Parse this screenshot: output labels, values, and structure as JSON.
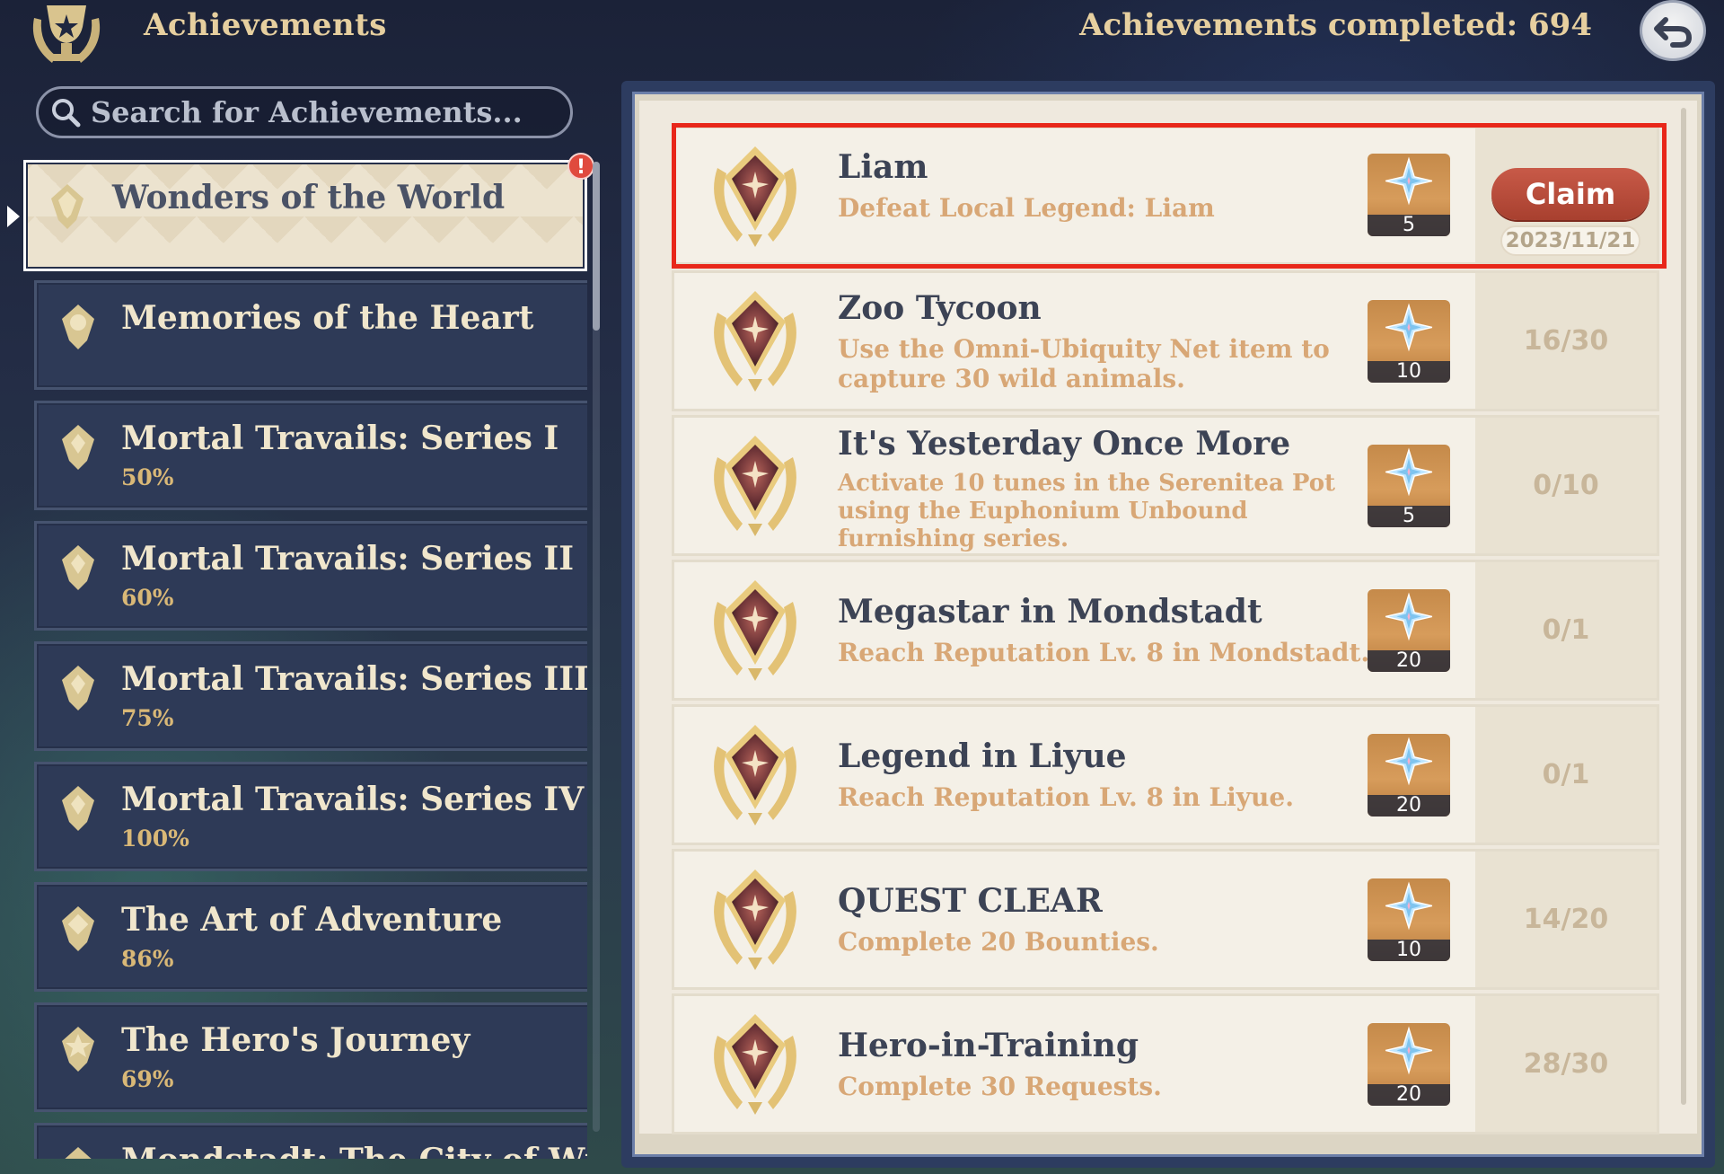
{
  "header": {
    "title": "Achievements",
    "completed_text": "Achievements completed: 694",
    "emblem_icon": "achievement-trophy-icon",
    "back_icon": "back-arrow-icon"
  },
  "search": {
    "placeholder": "Search for Achievements..."
  },
  "sidebar": {
    "categories": [
      {
        "name": "Wonders of the World",
        "progress": "",
        "active": true,
        "notification": "!"
      },
      {
        "name": "Memories of the Heart",
        "progress": ""
      },
      {
        "name": "Mortal Travails: Series I",
        "progress": "50%"
      },
      {
        "name": "Mortal Travails: Series II",
        "progress": "60%"
      },
      {
        "name": "Mortal Travails: Series III",
        "progress": "75%"
      },
      {
        "name": "Mortal Travails: Series IV",
        "progress": "100%"
      },
      {
        "name": "The Art of Adventure",
        "progress": "86%"
      },
      {
        "name": "The Hero's Journey",
        "progress": "69%"
      },
      {
        "name": "Mondstadt: The City of Wind",
        "progress": ""
      }
    ]
  },
  "achievements": [
    {
      "title": "Liam",
      "description": "Defeat Local Legend: Liam",
      "reward": "5",
      "status": "claim",
      "claim_label": "Claim",
      "date": "2023/11/21",
      "highlighted": true
    },
    {
      "title": "Zoo Tycoon",
      "description": "Use the Omni-Ubiquity Net item to capture 30 wild animals.",
      "reward": "10",
      "progress": "16/30"
    },
    {
      "title": "It's Yesterday Once More",
      "description": "Activate 10 tunes in the Serenitea Pot using the Euphonium Unbound furnishing series.",
      "reward": "5",
      "progress": "0/10"
    },
    {
      "title": "Megastar in Mondstadt",
      "description": "Reach Reputation Lv. 8 in Mondstadt.",
      "reward": "20",
      "progress": "0/1"
    },
    {
      "title": "Legend in Liyue",
      "description": "Reach Reputation Lv. 8 in Liyue.",
      "reward": "20",
      "progress": "0/1"
    },
    {
      "title": "QUEST CLEAR",
      "description": "Complete 20 Bounties.",
      "reward": "10",
      "progress": "14/20"
    },
    {
      "title": "Hero-in-Training",
      "description": "Complete 30 Requests.",
      "reward": "20",
      "progress": "28/30"
    }
  ],
  "colors": {
    "highlight_border": "#e8271a",
    "claim_button": "#b84a38",
    "title_gold": "#e6cf9f",
    "progress_text": "#c8b69a"
  }
}
